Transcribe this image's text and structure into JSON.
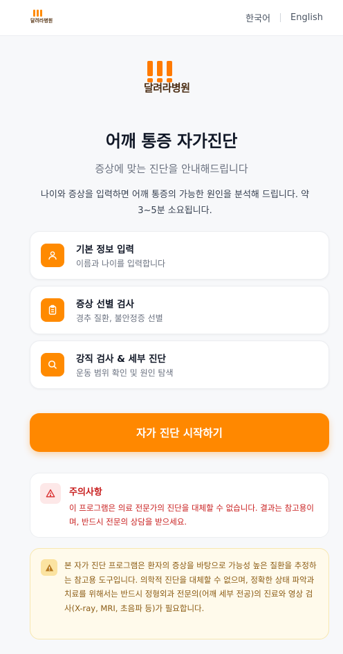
{
  "header": {
    "logo_text": "달려라병원",
    "lang_ko": "한국어",
    "lang_en": "English"
  },
  "hero": {
    "logo_text": "달려라병원",
    "title": "어깨 통증 자가진단",
    "subtitle": "증상에 맞는 진단을 안내해드립니다",
    "description": "나이와 증상을 입력하면 어깨 통증의 가능한 원인을 분석해 드립니다. 약 3~5분 소요됩니다."
  },
  "steps": [
    {
      "title": "기본 정보 입력",
      "desc": "이름과 나이를 입력합니다",
      "icon": "user-icon"
    },
    {
      "title": "증상 선별 검사",
      "desc": "경추 질환, 불안정증 선별",
      "icon": "clipboard-icon"
    },
    {
      "title": "강직 검사 & 세부 진단",
      "desc": "운동 범위 확인 및 원인 탐색",
      "icon": "search-icon"
    }
  ],
  "start_button": "자가 진단 시작하기",
  "caution": {
    "title": "주의사항",
    "body": "이 프로그램은 의료 전문가의 진단을 대체할 수 없습니다. 결과는 참고용이며, 반드시 전문의 상담을 받으세요."
  },
  "notice": {
    "body": "본 자가 진단 프로그램은 환자의 증상을 바탕으로 가능성 높은 질환을 추정하는 참고용 도구입니다. 의학적 진단을 대체할 수 없으며, 정확한 상태 파악과 치료를 위해서는 반드시 정형외과 전문의(어깨 세부 전공)의 진료와 영상 검사(X-ray, MRI, 초음파 등)가 필요합니다."
  },
  "colors": {
    "accent": "#ff8800",
    "danger": "#c81e1e",
    "warning_bg": "#fffaeb"
  }
}
